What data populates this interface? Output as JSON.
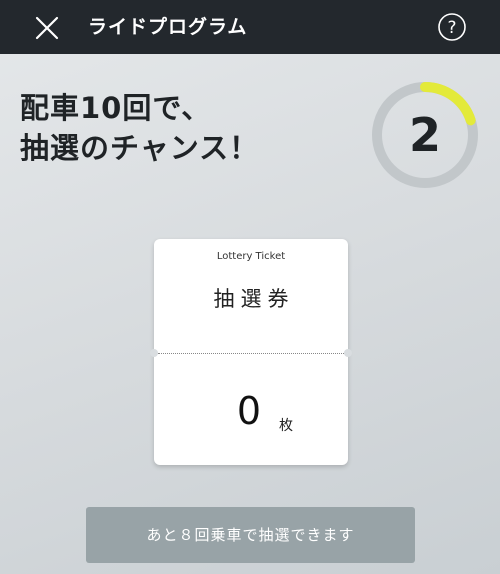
{
  "header": {
    "title": "ライドプログラム",
    "close_icon": "close-icon",
    "help_icon": "help-icon"
  },
  "promo": {
    "line1": "配車10回で、",
    "line2": "抽選のチャンス！"
  },
  "progress": {
    "count": "2",
    "goal": 10,
    "fraction": 0.2,
    "ring_color": "#c2c7ca",
    "progress_color": "#e3ea3a"
  },
  "ticket": {
    "title_en": "Lottery Ticket",
    "title_jp": "抽選券",
    "count": "0",
    "unit": "枚"
  },
  "action": {
    "label": "あと８回乗車で抽選できます",
    "button_color": "#98a3a7"
  },
  "colors": {
    "header_bg": "#23282d",
    "text_dark": "#1f2326"
  }
}
